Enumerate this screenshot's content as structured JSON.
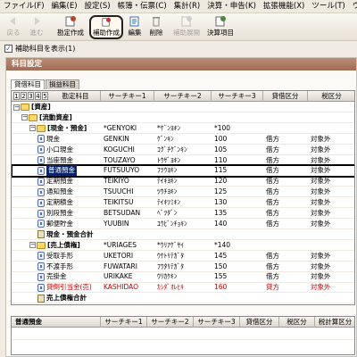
{
  "menubar": [
    "ファイル(F)",
    "編集(E)",
    "設定(S)",
    "帳簿・伝票(C)",
    "集計(R)",
    "決算・申告(K)",
    "拡張機能(X)",
    "ツール(T)",
    "ウィンドウ(W)"
  ],
  "toolbar": {
    "buttons": [
      {
        "label": "戻る",
        "icon": "back-icon",
        "disabled": true
      },
      {
        "label": "進む",
        "icon": "forward-icon",
        "disabled": true
      },
      {
        "label": "勘定作成",
        "icon": "account-create-icon",
        "disabled": false
      },
      {
        "label": "補助作成",
        "icon": "sub-account-create-icon",
        "disabled": false
      },
      {
        "label": "編集",
        "icon": "edit-icon",
        "disabled": false
      },
      {
        "label": "削除",
        "icon": "delete-icon",
        "disabled": false
      },
      {
        "label": "補助展開",
        "icon": "expand-icon",
        "disabled": true
      },
      {
        "label": "決算項目",
        "icon": "settlement-icon",
        "disabled": false
      }
    ]
  },
  "show_sub_accounts": {
    "checked": true,
    "label": "補助科目を表示(1)"
  },
  "panel": {
    "title": "科目設定"
  },
  "tabs": [
    "貸借科目",
    "損益科目"
  ],
  "grid": {
    "level_buttons": [
      "1",
      "2",
      "3",
      "4",
      "5"
    ],
    "columns": [
      "勘定科目",
      "サーチキー1",
      "サーチキー2",
      "サーチキー3",
      "貸借区分",
      "税区分"
    ],
    "rows": [
      {
        "indent": 0,
        "expand": "−",
        "icon": "folder",
        "name": "[資産]",
        "bold": true,
        "red": false,
        "k1": "",
        "k2": "",
        "k3": "",
        "dc": "",
        "tax": ""
      },
      {
        "indent": 1,
        "expand": "−",
        "icon": "folder",
        "name": "[流動資産]",
        "bold": true,
        "red": false,
        "k1": "",
        "k2": "",
        "k3": "",
        "dc": "",
        "tax": ""
      },
      {
        "indent": 2,
        "expand": "−",
        "icon": "folder",
        "name": "[現金・預金]",
        "bold": true,
        "red": false,
        "k1": "*GENYOKI",
        "k2": "*ｹﾞﾝﾖｷﾝ",
        "k3": "*100",
        "dc": "",
        "tax": ""
      },
      {
        "indent": 3,
        "expand": "",
        "icon": "acct",
        "name": "現金",
        "bold": false,
        "red": false,
        "k1": "GENKIN",
        "k2": "ｹﾞﾝｷﾝ",
        "k3": "100",
        "dc": "借方",
        "tax": "対象外"
      },
      {
        "indent": 3,
        "expand": "",
        "icon": "acct",
        "name": "小口現金",
        "bold": false,
        "red": false,
        "k1": "KOGUCHI",
        "k2": "ｺｸﾞﾁｹﾞﾝｷﾝ",
        "k3": "105",
        "dc": "借方",
        "tax": "対象外"
      },
      {
        "indent": 3,
        "expand": "",
        "icon": "acct",
        "name": "当座預金",
        "bold": false,
        "red": false,
        "k1": "TOUZAYO",
        "k2": "ﾄｳｻﾞﾖｷﾝ",
        "k3": "110",
        "dc": "借方",
        "tax": "対象外"
      },
      {
        "indent": 3,
        "expand": "",
        "icon": "acct",
        "name": "普通預金",
        "bold": false,
        "red": false,
        "selected": true,
        "k1": "FUTSUUYO",
        "k2": "ﾌﾂｳﾖｷﾝ",
        "k3": "115",
        "dc": "借方",
        "tax": "対象外"
      },
      {
        "indent": 3,
        "expand": "",
        "icon": "acct",
        "name": "定期預金",
        "bold": false,
        "red": false,
        "k1": "TEIKIYO",
        "k2": "ﾃｲｷﾖｷﾝ",
        "k3": "120",
        "dc": "借方",
        "tax": "対象外"
      },
      {
        "indent": 3,
        "expand": "",
        "icon": "acct",
        "name": "通知預金",
        "bold": false,
        "red": false,
        "k1": "TSUUCHI",
        "k2": "ﾂｳﾁﾖｷﾝ",
        "k3": "125",
        "dc": "借方",
        "tax": "対象外"
      },
      {
        "indent": 3,
        "expand": "",
        "icon": "acct",
        "name": "定期積金",
        "bold": false,
        "red": false,
        "k1": "TEIKITSU",
        "k2": "ﾃｲｷﾂﾐｷﾝ",
        "k3": "130",
        "dc": "借方",
        "tax": "対象外"
      },
      {
        "indent": 3,
        "expand": "",
        "icon": "acct",
        "name": "別段預金",
        "bold": false,
        "red": false,
        "k1": "BETSUDAN",
        "k2": "ﾍﾞﾂﾀﾞﾝ",
        "k3": "135",
        "dc": "借方",
        "tax": "対象外"
      },
      {
        "indent": 3,
        "expand": "",
        "icon": "acct",
        "name": "郵便貯金",
        "bold": false,
        "red": false,
        "k1": "YUUBIN",
        "k2": "ﾕｳﾋﾞﾝﾁｮｷﾝ",
        "k3": "140",
        "dc": "借方",
        "tax": "対象外"
      },
      {
        "indent": 3,
        "expand": "",
        "icon": "total",
        "name": "現金・預金合計",
        "bold": true,
        "red": false,
        "k1": "",
        "k2": "",
        "k3": "",
        "dc": "",
        "tax": ""
      },
      {
        "indent": 2,
        "expand": "−",
        "icon": "folder",
        "name": "[売上債権]",
        "bold": true,
        "red": false,
        "k1": "*URIAGES",
        "k2": "*ｳﾘｱｹﾞｻｲ",
        "k3": "*140",
        "dc": "",
        "tax": ""
      },
      {
        "indent": 3,
        "expand": "",
        "icon": "acct",
        "name": "受取手形",
        "bold": false,
        "red": false,
        "k1": "UKETORI",
        "k2": "ｳｹﾄﾘﾃｶﾞﾀ",
        "k3": "145",
        "dc": "借方",
        "tax": "対象外"
      },
      {
        "indent": 3,
        "expand": "",
        "icon": "acct",
        "name": "不渡手形",
        "bold": false,
        "red": false,
        "k1": "FUWATARI",
        "k2": "ﾌﾜﾀﾘﾃｶﾞﾀ",
        "k3": "150",
        "dc": "借方",
        "tax": "対象外"
      },
      {
        "indent": 3,
        "expand": "",
        "icon": "acct",
        "name": "売掛金",
        "bold": false,
        "red": false,
        "k1": "URIKAKE",
        "k2": "ｳﾘｶｹｷﾝ",
        "k3": "155",
        "dc": "借方",
        "tax": "対象外"
      },
      {
        "indent": 3,
        "expand": "",
        "icon": "acct",
        "name": "貸倒引当金(売)",
        "bold": false,
        "red": true,
        "k1": "KASHIDAO",
        "k2": "ｶｼﾀﾞｵﾚﾋｷ",
        "k3": "160",
        "dc": "貸方",
        "tax": "対象外"
      },
      {
        "indent": 3,
        "expand": "",
        "icon": "total",
        "name": "売上債権合計",
        "bold": true,
        "red": false,
        "k1": "",
        "k2": "",
        "k3": "",
        "dc": "",
        "tax": ""
      }
    ]
  },
  "bottom": {
    "title": "普通預金",
    "columns": [
      "サーチキー1",
      "サーチキー2",
      "サーチキー3",
      "貸借区分",
      "税区分",
      "税計算区分"
    ]
  }
}
